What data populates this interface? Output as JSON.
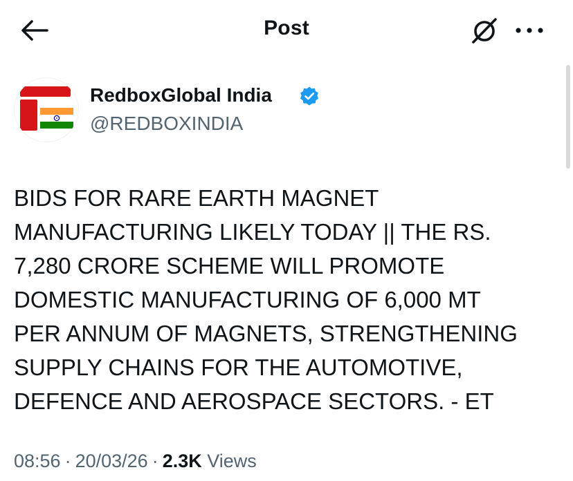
{
  "header": {
    "title": "Post",
    "back_icon": "back-arrow-icon",
    "grok_icon": "grok-icon",
    "more_icon": "more-icon"
  },
  "author": {
    "name": "RedboxGlobal India",
    "handle": "@REDBOXINDIA",
    "verified": true,
    "verified_color": "#1d9bf0"
  },
  "post": {
    "text": "BIDS FOR RARE EARTH MAGNET\nMANUFACTURING LIKELY TODAY || THE RS.\n7,280 CRORE SCHEME WILL PROMOTE\nDOMESTIC MANUFACTURING OF 6,000 MT\nPER ANNUM OF MAGNETS, STRENGTHENING\nSUPPLY CHAINS FOR THE AUTOMOTIVE,\nDEFENCE AND AEROSPACE SECTORS. - ET"
  },
  "meta": {
    "time": "08:56",
    "date": "20/03/26",
    "views_count": "2.3K",
    "views_label": "Views",
    "separator": "·"
  },
  "colors": {
    "text_primary": "#0f1419",
    "text_secondary": "#536471",
    "logo_red": "#d7141a",
    "flag_saffron": "#ff9933",
    "flag_green": "#138808",
    "chakra_blue": "#000080"
  }
}
